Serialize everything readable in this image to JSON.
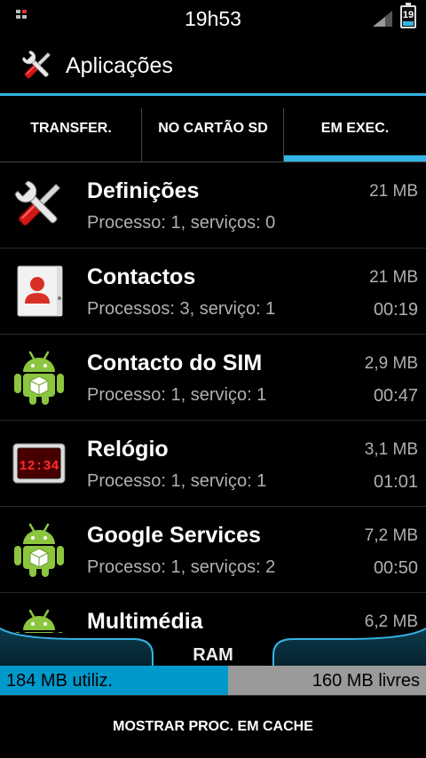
{
  "status_bar": {
    "time": "19h53",
    "battery_level": "19",
    "icons": [
      "notification-icon",
      "signal-icon",
      "battery-icon"
    ]
  },
  "action_bar": {
    "title": "Aplicações",
    "icon": "settings-tools-icon"
  },
  "tabs": [
    {
      "label": "TRANSFER.",
      "selected": false
    },
    {
      "label": "NO CARTÃO SD",
      "selected": false
    },
    {
      "label": "EM EXEC.",
      "selected": true
    }
  ],
  "apps": [
    {
      "name": "Definições",
      "detail": "Processo: 1, serviços: 0",
      "size": "21 MB",
      "time": "",
      "icon": "settings-tools-icon"
    },
    {
      "name": "Contactos",
      "detail": "Processos: 3, serviço: 1",
      "size": "21 MB",
      "time": "00:19",
      "icon": "contacts-icon"
    },
    {
      "name": "Contacto do SIM",
      "detail": "Processo: 1, serviço: 1",
      "size": "2,9 MB",
      "time": "00:47",
      "icon": "android-icon"
    },
    {
      "name": "Relógio",
      "detail": "Processo: 1, serviço: 1",
      "size": "3,1 MB",
      "time": "01:01",
      "icon": "clock-icon",
      "clock_face": "12:34"
    },
    {
      "name": "Google Services",
      "detail": "Processo: 1, serviços: 2",
      "size": "7,2 MB",
      "time": "00:50",
      "icon": "android-icon"
    },
    {
      "name": "Multimédia",
      "detail": "",
      "size": "6,2 MB",
      "time": "",
      "icon": "android-icon"
    }
  ],
  "ram": {
    "label": "RAM",
    "used_text": "184 MB utiliz.",
    "free_text": "160 MB livres",
    "used_fraction": 0.535
  },
  "footer": {
    "button_label": "MOSTRAR PROC. EM CACHE"
  },
  "colors": {
    "accent": "#33b5e5",
    "ram_used": "#0099cc",
    "ram_free": "#9a9a9a",
    "android_green": "#8cc63f"
  }
}
